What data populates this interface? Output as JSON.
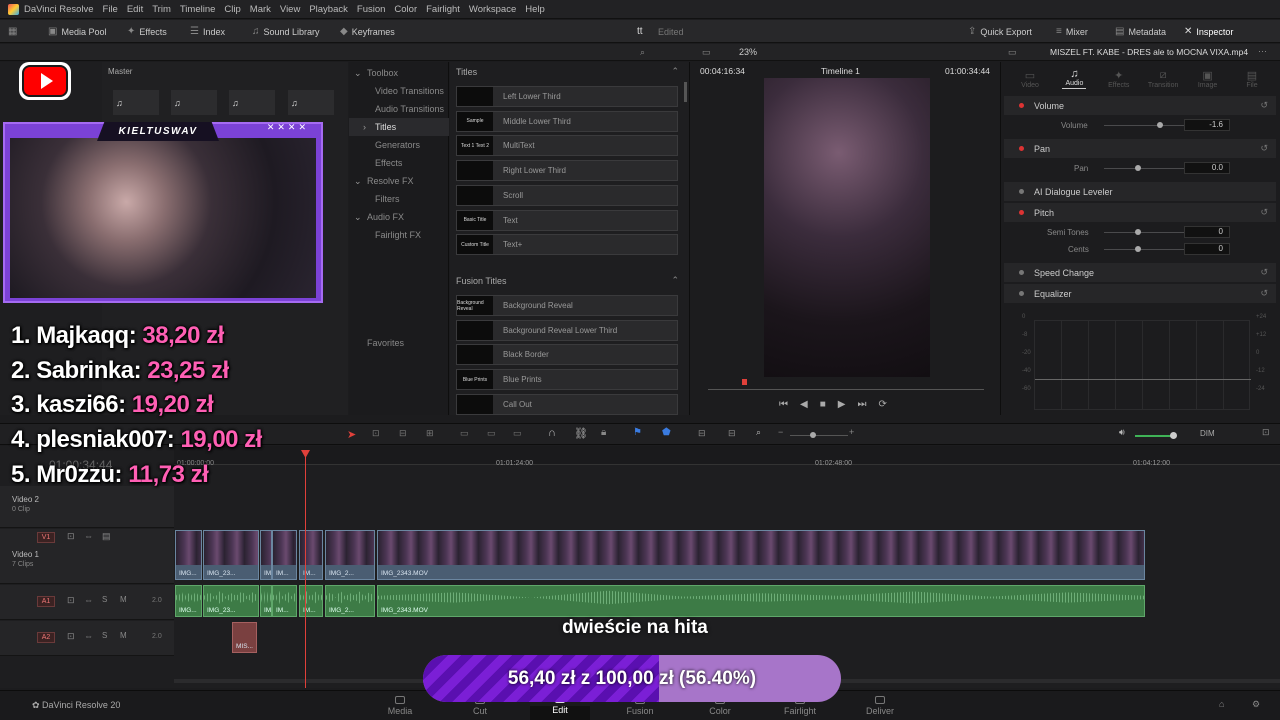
{
  "menubar": {
    "app": "DaVinci Resolve",
    "items": [
      "File",
      "Edit",
      "Trim",
      "Timeline",
      "Clip",
      "Mark",
      "View",
      "Playback",
      "Fusion",
      "Color",
      "Fairlight",
      "Workspace",
      "Help"
    ]
  },
  "toolbar": {
    "media_pool": "Media Pool",
    "effects": "Effects",
    "index": "Index",
    "sound_library": "Sound Library",
    "keyframes": "Keyframes",
    "project_name": "tt",
    "project_status": "Edited",
    "quick_export": "Quick Export",
    "mixer": "Mixer",
    "metadata": "Metadata",
    "inspector": "Inspector"
  },
  "subbar": {
    "zoom": "23%",
    "clip_name": "MISZEL FT. KABE - DRES ale to MOCNA VIXA.mp4"
  },
  "media_pool": {
    "bin": "Master"
  },
  "effects_nav": {
    "items": [
      {
        "label": "Toolbox",
        "indent": false,
        "active": false
      },
      {
        "label": "Video Transitions",
        "indent": true,
        "active": false
      },
      {
        "label": "Audio Transitions",
        "indent": true,
        "active": false
      },
      {
        "label": "Titles",
        "indent": true,
        "active": true
      },
      {
        "label": "Generators",
        "indent": true,
        "active": false
      },
      {
        "label": "Effects",
        "indent": true,
        "active": false
      },
      {
        "label": "Resolve FX",
        "indent": false,
        "active": false
      },
      {
        "label": "Filters",
        "indent": true,
        "active": false
      },
      {
        "label": "Audio FX",
        "indent": false,
        "active": false
      },
      {
        "label": "Fairlight FX",
        "indent": true,
        "active": false
      }
    ],
    "favorites": "Favorites"
  },
  "effects_list": {
    "titles_header": "Titles",
    "titles": [
      {
        "label": "Left Lower Third",
        "thumb": ""
      },
      {
        "label": "Middle Lower Third",
        "thumb": "Sample"
      },
      {
        "label": "MultiText",
        "thumb": "Text 1 Text 2"
      },
      {
        "label": "Right Lower Third",
        "thumb": ""
      },
      {
        "label": "Scroll",
        "thumb": ""
      },
      {
        "label": "Text",
        "thumb": "Basic Title"
      },
      {
        "label": "Text+",
        "thumb": "Custom Title"
      }
    ],
    "fusion_header": "Fusion Titles",
    "fusion_titles": [
      {
        "label": "Background Reveal",
        "thumb": "Background Reveal"
      },
      {
        "label": "Background Reveal Lower Third",
        "thumb": ""
      },
      {
        "label": "Black Border",
        "thumb": ""
      },
      {
        "label": "Blue Prints",
        "thumb": "Blue Prints"
      },
      {
        "label": "Call Out",
        "thumb": ""
      }
    ]
  },
  "viewer": {
    "duration": "00:04:16:34",
    "timeline_name": "Timeline 1",
    "timecode": "01:00:34:44"
  },
  "inspector": {
    "tabs": [
      "Video",
      "Audio",
      "Effects",
      "Transition",
      "Image",
      "File"
    ],
    "active_tab": "Audio",
    "sections": {
      "volume": {
        "title": "Volume",
        "param": "Volume",
        "value": "-1.6"
      },
      "pan": {
        "title": "Pan",
        "param": "Pan",
        "value": "0.0"
      },
      "dialogue": {
        "title": "AI Dialogue Leveler"
      },
      "pitch": {
        "title": "Pitch",
        "semitones_label": "Semi Tones",
        "semitones": "0",
        "cents_label": "Cents",
        "cents": "0"
      },
      "speed": {
        "title": "Speed Change"
      },
      "equalizer": {
        "title": "Equalizer",
        "db_labels": [
          "+24",
          "+12",
          "0",
          "-12",
          "-24"
        ],
        "db_labels_left": [
          "0",
          "-8",
          "-20",
          "-40",
          "-60"
        ]
      }
    }
  },
  "timeline": {
    "timecode": "01:00:34:44",
    "ruler": [
      "01:00:00:00",
      "01:01:24:00",
      "01:02:48:00",
      "01:04:12:00"
    ],
    "master_level": "DIM",
    "tracks": {
      "v2": {
        "badge": "",
        "name": "Video 2",
        "count": "0 Clip"
      },
      "v1": {
        "badge": "V1",
        "name": "Video 1",
        "count": "7 Clips"
      },
      "a1": {
        "badge": "A1",
        "level": "2.0"
      },
      "a2": {
        "badge": "A2",
        "level": "2.0"
      }
    },
    "video_clips": [
      "IMG...",
      "IMG_23...",
      "IM...",
      "IM...",
      "IMG_2...",
      "IMG_2343.MOV"
    ],
    "audio_clips": [
      "IMG...",
      "IMG_23...",
      "IM...",
      "IM...",
      "IMG_2...",
      "IMG_2343.MOV"
    ],
    "a2_clip": "MIS..."
  },
  "pages": {
    "app_label": "DaVinci Resolve 20",
    "items": [
      "Media",
      "Cut",
      "Edit",
      "Fusion",
      "Color",
      "Fairlight",
      "Deliver"
    ],
    "active": "Edit"
  },
  "overlay": {
    "webcam_name": "KIELTUSWAV",
    "leaderboard": [
      {
        "rank": "1.",
        "name": "Majkaqq:",
        "amount": "38,20 zł"
      },
      {
        "rank": "2.",
        "name": "Sabrinka:",
        "amount": "23,25 zł"
      },
      {
        "rank": "3.",
        "name": "kaszi66:",
        "amount": "19,20 zł"
      },
      {
        "rank": "4.",
        "name": "plesniak007:",
        "amount": "19,00 zł"
      },
      {
        "rank": "5.",
        "name": "Mr0zzu:",
        "amount": "11,73 zł"
      }
    ],
    "goal_title": "dwieście na hita",
    "goal_text": "56,40 zł  z  100,00 zł (56.40%)",
    "goal_progress": 0.564
  },
  "colors": {
    "accent_red": "#e0403a",
    "video_clip": "#4a5d72",
    "audio_clip": "#3d7b46",
    "goal_fill": "#7b1fd6",
    "leaderboard_amount": "#ff5fb4"
  }
}
